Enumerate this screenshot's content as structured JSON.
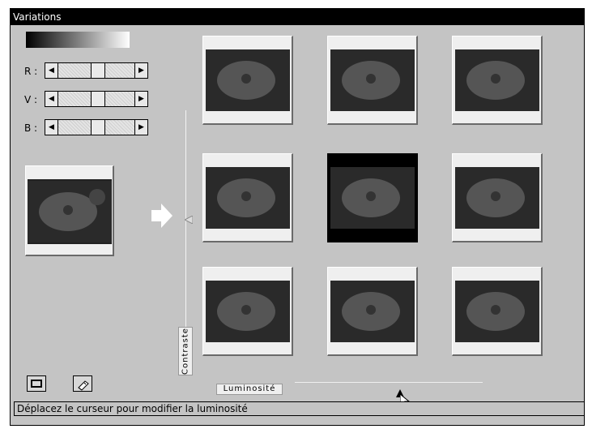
{
  "window": {
    "title": "Variations"
  },
  "color_sliders": [
    {
      "label": "R :",
      "value": 0.5
    },
    {
      "label": "V :",
      "value": 0.5
    },
    {
      "label": "B :",
      "value": 0.5
    }
  ],
  "contrast_label": "Contraste",
  "luminosity_label": "Luminosité",
  "status_text": "Déplacez le curseur pour modifier la luminosité",
  "variations_grid": {
    "rows": 3,
    "cols": 3,
    "selected": "center"
  },
  "icons": [
    "arrow-right-icon",
    "window-icon",
    "help-book-icon",
    "cursor-pointer-icon"
  ]
}
